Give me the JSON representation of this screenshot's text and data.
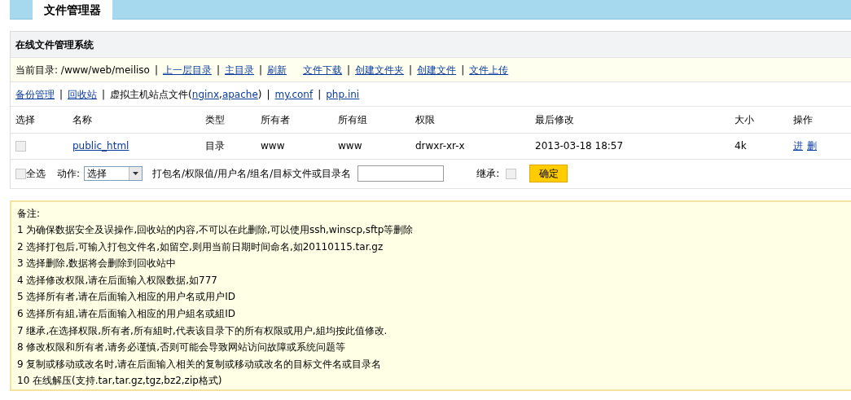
{
  "tab": {
    "label": "文件管理器",
    "selected": true
  },
  "panel_title": "在线文件管理系统",
  "path_bar": [
    {
      "kind": "text",
      "text": "当前目录: /www/web/meiliso"
    },
    {
      "kind": "sep",
      "text": "|"
    },
    {
      "kind": "link",
      "text": "上一层目录"
    },
    {
      "kind": "sep",
      "text": "|"
    },
    {
      "kind": "link",
      "text": "主目录"
    },
    {
      "kind": "sep",
      "text": "|"
    },
    {
      "kind": "link",
      "text": "刷新"
    },
    {
      "kind": "spacer"
    },
    {
      "kind": "link",
      "text": "文件下载"
    },
    {
      "kind": "sep",
      "text": "|"
    },
    {
      "kind": "link",
      "text": "创建文件夹"
    },
    {
      "kind": "sep",
      "text": "|"
    },
    {
      "kind": "link",
      "text": "创建文件"
    },
    {
      "kind": "sep",
      "text": "|"
    },
    {
      "kind": "link",
      "text": "文件上传"
    }
  ],
  "tools_bar": [
    {
      "kind": "link",
      "text": "备份管理"
    },
    {
      "kind": "sep",
      "text": "|"
    },
    {
      "kind": "link",
      "text": "回收站"
    },
    {
      "kind": "sep",
      "text": "|"
    },
    {
      "kind": "text",
      "text": "虚拟主机站点文件("
    },
    {
      "kind": "link",
      "text": "nginx"
    },
    {
      "kind": "text",
      "text": ","
    },
    {
      "kind": "link",
      "text": "apache"
    },
    {
      "kind": "text",
      "text": ")"
    },
    {
      "kind": "sep",
      "text": "|"
    },
    {
      "kind": "link",
      "text": "my.conf"
    },
    {
      "kind": "sep",
      "text": "|"
    },
    {
      "kind": "link",
      "text": "php.ini"
    }
  ],
  "table": {
    "columns": [
      "选择",
      "名称",
      "类型",
      "所有者",
      "所有组",
      "权限",
      "最后修改",
      "大小",
      "操作"
    ],
    "rows": [
      {
        "checked": false,
        "name": "public_html",
        "type": "目录",
        "owner": "www",
        "group": "www",
        "permissions": "drwxr-xr-x",
        "modified": "2013-03-18 18:57",
        "size": "4k",
        "actions": [
          "进",
          "删"
        ]
      }
    ]
  },
  "footer": {
    "select_all": {
      "label": "全选",
      "checked": false
    },
    "action_label": "动作:",
    "action_select": "选择",
    "target_label": "打包名/权限值/用户名/组名/目标文件或目录名",
    "inherit_label": "继承:",
    "inherit_checked": false,
    "confirm": "确定"
  },
  "notes": {
    "title": "备注:",
    "lines": [
      "1 为确保数据安全及误操作,回收站的内容,不可以在此删除,可以使用ssh,winscp,sftp等删除",
      "2 选择打包后,可输入打包文件名,如留空,则用当前日期时间命名,如20110115.tar.gz",
      "3 选择删除,数据将会删除到回收站中",
      "4 选择修改权限,请在后面输入权限数据,如777",
      "5 选择所有者,请在后面输入相应的用户名或用户ID",
      "6 选择所有組,请在后面输入相应的用户組名或組ID",
      "7 继承,在选择权限,所有者,所有組时,代表该目录下的所有权限或用户,組均按此值修改.",
      "8 修改权限和所有者,请务必谨慎,否则可能会导致网站访问故障或系统问题等",
      "9 复制或移动或改名时,请在后面输入相关的复制或移动或改名的目标文件名或目录名",
      "10 在线解压(支持.tar,tar.gz,tgz,bz2,zip格式)"
    ]
  }
}
